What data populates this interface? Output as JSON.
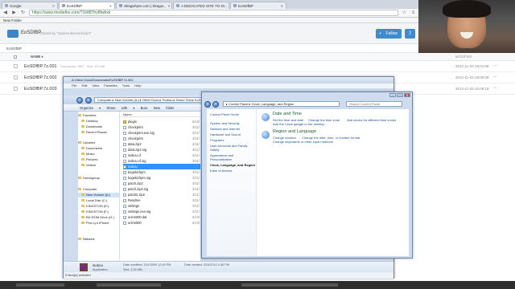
{
  "browser": {
    "tabs": [
      {
        "label": "Google",
        "active": false
      },
      {
        "label": "EoSDfBP",
        "active": true
      },
      {
        "label": "Skagwhyte.com | Skagw...",
        "active": false
      },
      {
        "label": "A DEDICATED SITE TO DI...",
        "active": false
      },
      {
        "label": "EoSDfBP",
        "active": false
      }
    ],
    "url": "https://www.mediafire.com/?1b887hy8fwbxk",
    "bookmarks_label": "New Folder"
  },
  "mediafire": {
    "folder_name": "EoSDfBP",
    "shared_by": "Shared by \"SaeiHuuhHAuhHuuhr\"",
    "follow_label": "Follow",
    "follow_plus": "+",
    "share_glyph": "⇪",
    "breadcrumb": "EoSDfBP",
    "columns": {
      "name": "NAME ▾",
      "modified": "MODIFIED"
    },
    "rows": [
      {
        "name": "EoSDfBP.7z.001",
        "meta": "Downloads: 1967 · Size: 200 MB",
        "date": "2012-11-03 18:01:08"
      },
      {
        "name": "EoSDfBP.7z.002",
        "meta": "",
        "date": "2012-11-03 18:08:08"
      },
      {
        "name": "EoSDfBP.7z.003",
        "meta": "",
        "date": "2012-11-03 18:09:18"
      }
    ]
  },
  "explorer": {
    "title": "A:\\Other Docs\\Downloads\\EoSDfBP.7z.001",
    "menu": "File Edit View Favorites Tools Help",
    "address": "Computer ▸ New Volume (A:) ▸ Other Docs ▸ Touhou ▸ Demo Test ▸ EoSDfBP ▸",
    "search_placeholder": "Search EoSDfBP",
    "toolbar": "Organize ▾ Share with ▾ Burn New folder",
    "nav_pane": [
      {
        "label": "Favorites",
        "sel": false
      },
      {
        "label": "Desktop",
        "sel": false
      },
      {
        "label": "Downloads",
        "sel": false
      },
      {
        "label": "Recent Places",
        "sel": false
      },
      {
        "label": "Libraries",
        "sel": false
      },
      {
        "label": "Documents",
        "sel": false
      },
      {
        "label": "Music",
        "sel": false
      },
      {
        "label": "Pictures",
        "sel": false
      },
      {
        "label": "Videos",
        "sel": false
      },
      {
        "label": "Homegroup",
        "sel": false
      },
      {
        "label": "Computer",
        "sel": false
      },
      {
        "label": "New Volume (A:)",
        "sel": true
      },
      {
        "label": "Local Disk (C:)",
        "sel": false
      },
      {
        "label": "KINGSTON (E:)",
        "sel": false
      },
      {
        "label": "KINGSTON (F:)",
        "sel": false
      },
      {
        "label": "BD-ROM Drive (G:)",
        "sel": false
      },
      {
        "label": "Phu Ly's iPhone",
        "sel": false
      },
      {
        "label": "Network",
        "sel": false
      }
    ],
    "files_header": "Name",
    "files": [
      {
        "name": "plugin",
        "folder": true,
        "date": "6/10/",
        "sel": false
      },
      {
        "name": "checkprint",
        "folder": false,
        "date": "3/11/",
        "sel": false
      },
      {
        "name": "checkprint.exe.sig",
        "folder": false,
        "date": "3/11/",
        "sel": false
      },
      {
        "name": "checkprint",
        "folder": false,
        "date": "3/11/",
        "sel": false
      },
      {
        "name": "data.zip2",
        "folder": false,
        "date": "3/11/",
        "sel": false
      },
      {
        "name": "data.zip2.sig",
        "folder": false,
        "date": "3/11/",
        "sel": false
      },
      {
        "name": "isokou.cf",
        "folder": false,
        "date": "3/11/",
        "sel": false
      },
      {
        "name": "isokou.cf.sig",
        "folder": false,
        "date": "3/11/",
        "sel": false
      },
      {
        "name": "isokou",
        "folder": false,
        "date": "3/11/",
        "sel": true
      },
      {
        "name": "kogekichpm",
        "folder": false,
        "date": "3/11/",
        "sel": false
      },
      {
        "name": "kogekichpm.sig",
        "folder": false,
        "date": "3/11/",
        "sel": false
      },
      {
        "name": "patch.zip2",
        "folder": false,
        "date": "3/11/",
        "sel": false
      },
      {
        "name": "patch.zip2.sig",
        "folder": false,
        "date": "3/11/",
        "sel": false
      },
      {
        "name": "patch2.zip2",
        "folder": false,
        "date": "3/11/",
        "sel": false
      },
      {
        "name": "Readme",
        "folder": false,
        "date": "3/11/",
        "sel": false
      },
      {
        "name": "settings",
        "folder": false,
        "date": "3/11/",
        "sel": false
      },
      {
        "name": "settings.exe.sig",
        "folder": false,
        "date": "3/11/",
        "sel": false
      },
      {
        "name": "unins000.dat",
        "folder": false,
        "date": "6/10/",
        "sel": false
      },
      {
        "name": "unins000",
        "folder": false,
        "date": "6/10/",
        "sel": false
      }
    ],
    "details": {
      "name": "isokou",
      "kind": "Application",
      "modified": "Date modified: 3/11/2009 12:00 PM",
      "size": "Size: 3.20 MB",
      "created": "Date created: 2/24/2010 4:38 PM"
    },
    "status": "0 item(s) selected"
  },
  "control_panel": {
    "address": "▸ Control Panel ▸ Clock, Language, and Region",
    "search_placeholder": "Search Control Panel",
    "sidebar": [
      {
        "label": "Control Panel Home",
        "current": false
      },
      {
        "label": "System and Security",
        "current": false
      },
      {
        "label": "Network and Internet",
        "current": false
      },
      {
        "label": "Hardware and Sound",
        "current": false
      },
      {
        "label": "Programs",
        "current": false
      },
      {
        "label": "User Accounts and Family",
        "current": false
      },
      {
        "label": "Safety",
        "current": false
      },
      {
        "label": "Appearance and",
        "current": false
      },
      {
        "label": "Personalization",
        "current": false
      },
      {
        "label": "Clock, Language, and Region",
        "current": true
      },
      {
        "label": "Ease of Access",
        "current": false
      }
    ],
    "sections": [
      {
        "heading": "Date and Time",
        "links": [
          "Set the time and date",
          "Change the time zone",
          "Add clocks for different time zones",
          "Add the Clock gadget to the desktop"
        ]
      },
      {
        "heading": "Region and Language",
        "links": [
          "Change location",
          "Change the date, time, or number format",
          "Change keyboards or other input methods"
        ]
      }
    ]
  }
}
